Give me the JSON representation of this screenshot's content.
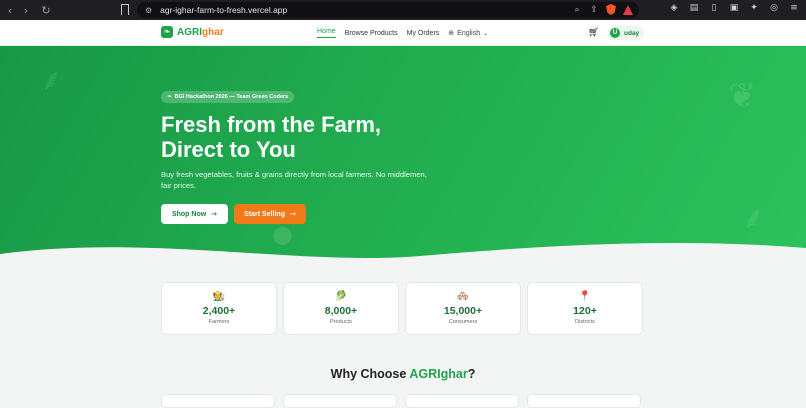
{
  "browser": {
    "url": "agr-ighar-farm-to-fresh.vercel.app",
    "back_icon": "chevron-left",
    "forward_icon": "chevron-right",
    "reload_icon": "reload",
    "bookmark_icon": "bookmark"
  },
  "nav": {
    "logo_prefix": "AGRI",
    "logo_suffix": "ghar",
    "links": [
      "Home",
      "Browse Products",
      "My Orders"
    ],
    "language": "English",
    "user_initial": "U",
    "user_name": "uday"
  },
  "hero": {
    "badge": "BGI Hackathon 2026 — Team Green Coders",
    "title_line1": "Fresh from the Farm,",
    "title_line2": "Direct to You",
    "subtitle": "Buy fresh vegetables, fruits & grains directly from local farmers. No middlemen, fair prices.",
    "shop_label": "Shop Now",
    "sell_label": "Start Selling"
  },
  "stats": [
    {
      "icon": "🧑‍🌾",
      "value": "2,400+",
      "label": "Farmers"
    },
    {
      "icon": "🥬",
      "value": "8,000+",
      "label": "Products"
    },
    {
      "icon": "🏘️",
      "value": "15,000+",
      "label": "Consumers"
    },
    {
      "icon": "📍",
      "value": "120+",
      "label": "Districts"
    }
  ],
  "why": {
    "prefix": "Why Choose ",
    "brand": "AGRIghar",
    "suffix": "?"
  },
  "colors": {
    "primary_green": "#1fa34a",
    "accent_orange": "#f07a18"
  }
}
